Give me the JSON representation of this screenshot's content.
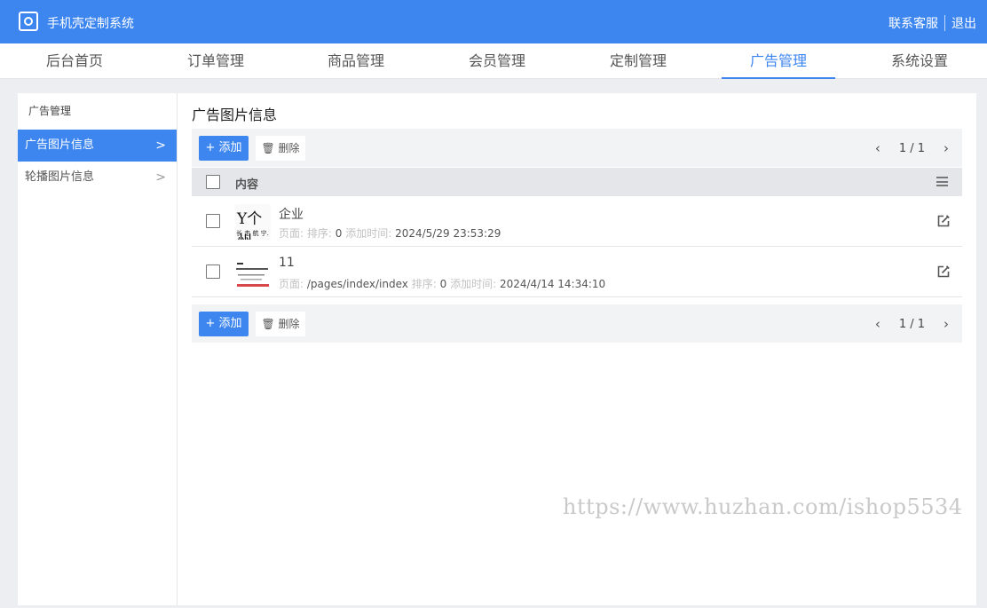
{
  "app": {
    "title": "手机壳定制系统",
    "logo_icon": "safe-box-icon"
  },
  "top_links": {
    "support": "联系客服",
    "logout": "退出"
  },
  "nav": {
    "tabs": [
      {
        "label": "后台首页"
      },
      {
        "label": "订单管理"
      },
      {
        "label": "商品管理"
      },
      {
        "label": "会员管理"
      },
      {
        "label": "定制管理"
      },
      {
        "label": "广告管理",
        "active": true
      },
      {
        "label": "系统设置"
      }
    ]
  },
  "sidebar": {
    "heading": "广告管理",
    "items": [
      {
        "label": "广告图片信息",
        "active": true,
        "chevron": ">"
      },
      {
        "label": "轮播图片信息",
        "chevron": ">"
      }
    ]
  },
  "content": {
    "title": "广告图片信息",
    "add_label": "+ 添加",
    "delete_label": "删除",
    "pager": {
      "prev": "‹",
      "text": "1 / 1",
      "next": "›"
    },
    "column_header": "内容",
    "rows": [
      {
        "title": "企业",
        "page_label": "页面:",
        "page_value": "",
        "sort_label": "排序:",
        "sort_value": "0",
        "time_label": "添加时间:",
        "time_value": "2024/5/29 23:53:29",
        "thumb_text_top": "Y个州",
        "thumb_text_bottom": "长 走 航 宁."
      },
      {
        "title": "11",
        "page_label": "页面:",
        "page_value": "/pages/index/index",
        "sort_label": "排序:",
        "sort_value": "0",
        "time_label": "添加时间:",
        "time_value": "2024/4/14 14:34:10"
      }
    ]
  },
  "watermark": "https://www.huzhan.com/ishop5534",
  "colors": {
    "accent": "#3d86f0",
    "toolbar_bg": "#f2f3f5",
    "header_bg": "#e4e6ea"
  }
}
